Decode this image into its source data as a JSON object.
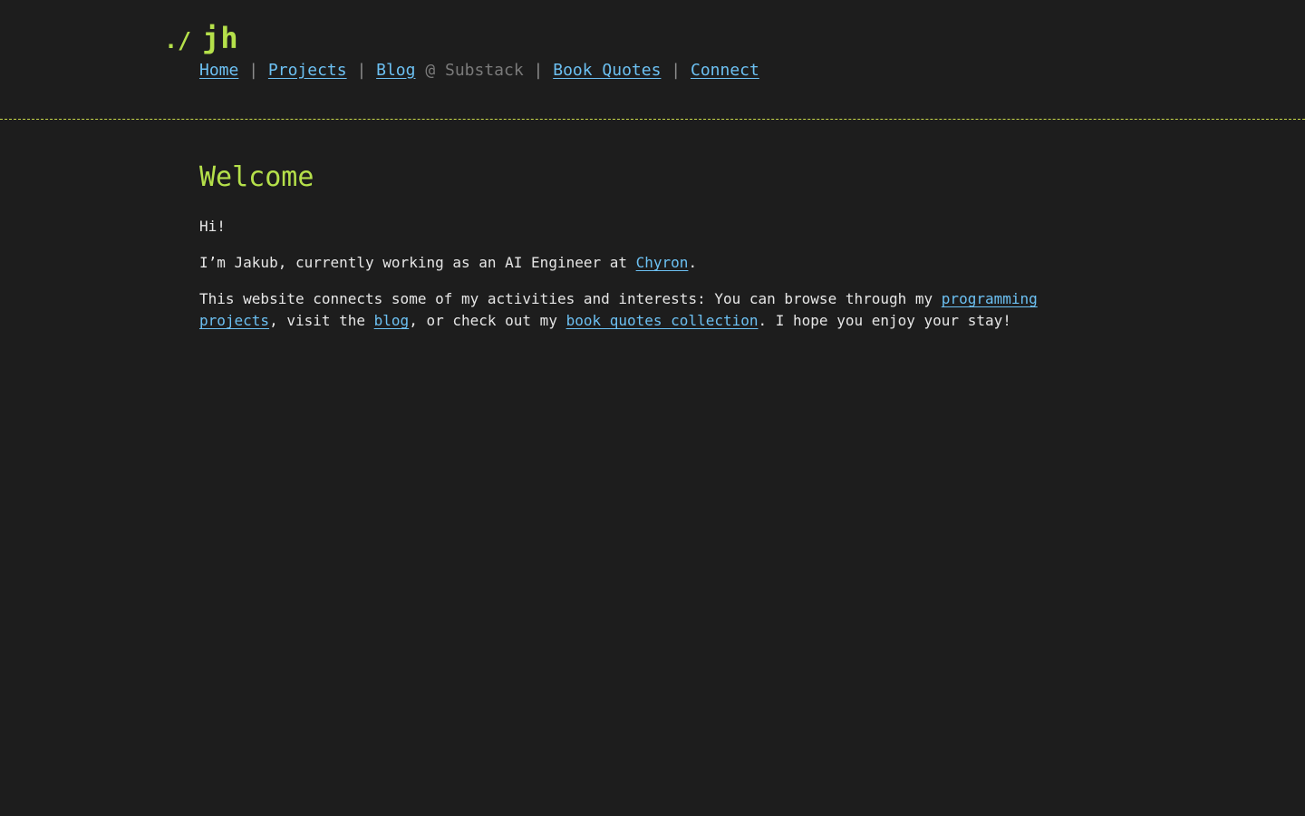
{
  "header": {
    "logo_prefix": "./",
    "logo_name": "jh"
  },
  "nav": {
    "home": "Home",
    "sep1": "|",
    "projects": "Projects",
    "sep2": "|",
    "blog": "Blog",
    "substack_note": "@ Substack",
    "sep3": "|",
    "book_quotes": "Book Quotes",
    "sep4": "|",
    "connect": "Connect"
  },
  "main": {
    "title": "Welcome",
    "greeting": "Hi!",
    "intro_before": "I’m Jakub, currently working as an AI Engineer at ",
    "intro_link": "Chyron",
    "intro_after": ".",
    "about_before": "This website connects some of my activities and interests: You can browse through my ",
    "about_link1": "programming projects",
    "about_mid1": ", visit the ",
    "about_link2": "blog",
    "about_mid2": ", or check out my ",
    "about_link3": "book quotes collection",
    "about_after": ". I hope you enjoy your stay!"
  },
  "colors": {
    "background": "#1d1d1d",
    "accent_green": "#b5e04a",
    "link_blue": "#6cc0f2",
    "divider": "#c9d94a"
  }
}
